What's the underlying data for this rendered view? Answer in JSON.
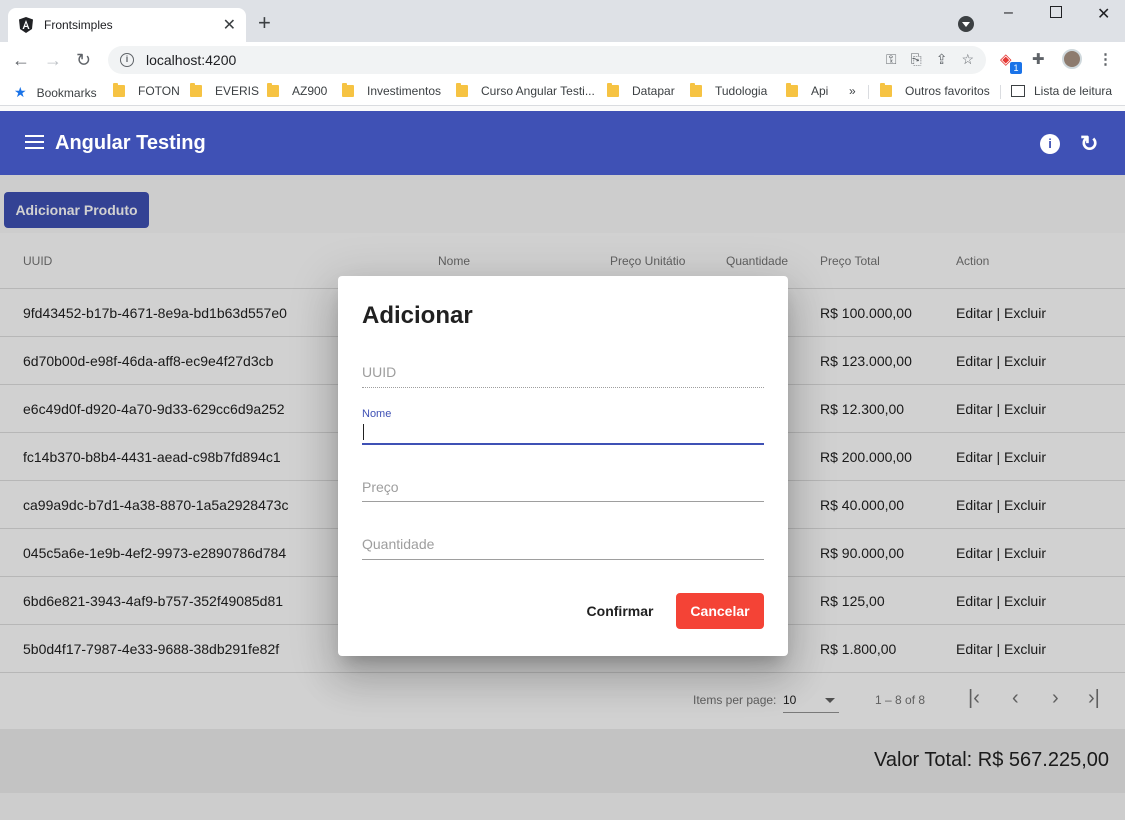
{
  "browser": {
    "tab_title": "Frontsimples",
    "url": "localhost:4200",
    "bookmarks": [
      "Bookmarks",
      "FOTON",
      "EVERIS",
      "AZ900",
      "Investimentos",
      "Curso Angular Testi...",
      "Datapar",
      "Tudologia",
      "Api"
    ],
    "overflow": "»",
    "other_bookmarks": "Outros favoritos",
    "reading_list": "Lista de leitura",
    "extension_badge": "1"
  },
  "app": {
    "title": "Angular Testing",
    "add_button": "Adicionar Produto",
    "brand_color": "#3f51b5"
  },
  "table": {
    "headers": {
      "uuid": "UUID",
      "nome": "Nome",
      "preco": "Preço Unitátio",
      "quantidade": "Quantidade",
      "total": "Preço Total",
      "action": "Action"
    },
    "rows": [
      {
        "uuid": "9fd43452-b17b-4671-8e9a-bd1b63d557e0",
        "total": "R$ 100.000,00",
        "action": "Editar | Excluir"
      },
      {
        "uuid": "6d70b00d-e98f-46da-aff8-ec9e4f27d3cb",
        "total": "R$ 123.000,00",
        "action": "Editar | Excluir"
      },
      {
        "uuid": "e6c49d0f-d920-4a70-9d33-629cc6d9a252",
        "total": "R$ 12.300,00",
        "action": "Editar | Excluir"
      },
      {
        "uuid": "fc14b370-b8b4-4431-aead-c98b7fd894c1",
        "total": "R$ 200.000,00",
        "action": "Editar | Excluir"
      },
      {
        "uuid": "ca99a9dc-b7d1-4a38-8870-1a5a2928473c",
        "total": "R$ 40.000,00",
        "action": "Editar | Excluir"
      },
      {
        "uuid": "045c5a6e-1e9b-4ef2-9973-e2890786d784",
        "total": "R$ 90.000,00",
        "action": "Editar | Excluir"
      },
      {
        "uuid": "6bd6e821-3943-4af9-b757-352f49085d81",
        "total": "R$ 125,00",
        "action": "Editar | Excluir"
      },
      {
        "uuid": "5b0d4f17-7987-4e33-9688-38db291fe82f",
        "total": "R$ 1.800,00",
        "action": "Editar | Excluir"
      }
    ]
  },
  "paginator": {
    "items_label": "Items per page:",
    "page_size": "10",
    "range": "1 – 8 of 8"
  },
  "summary": {
    "total": "Valor Total: R$ 567.225,00"
  },
  "dialog": {
    "title": "Adicionar",
    "uuid_placeholder": "UUID",
    "nome_label": "Nome",
    "nome_value": "",
    "preco_placeholder": "Preço",
    "quantidade_placeholder": "Quantidade",
    "confirm": "Confirmar",
    "cancel": "Cancelar",
    "cancel_color": "#f44336"
  }
}
